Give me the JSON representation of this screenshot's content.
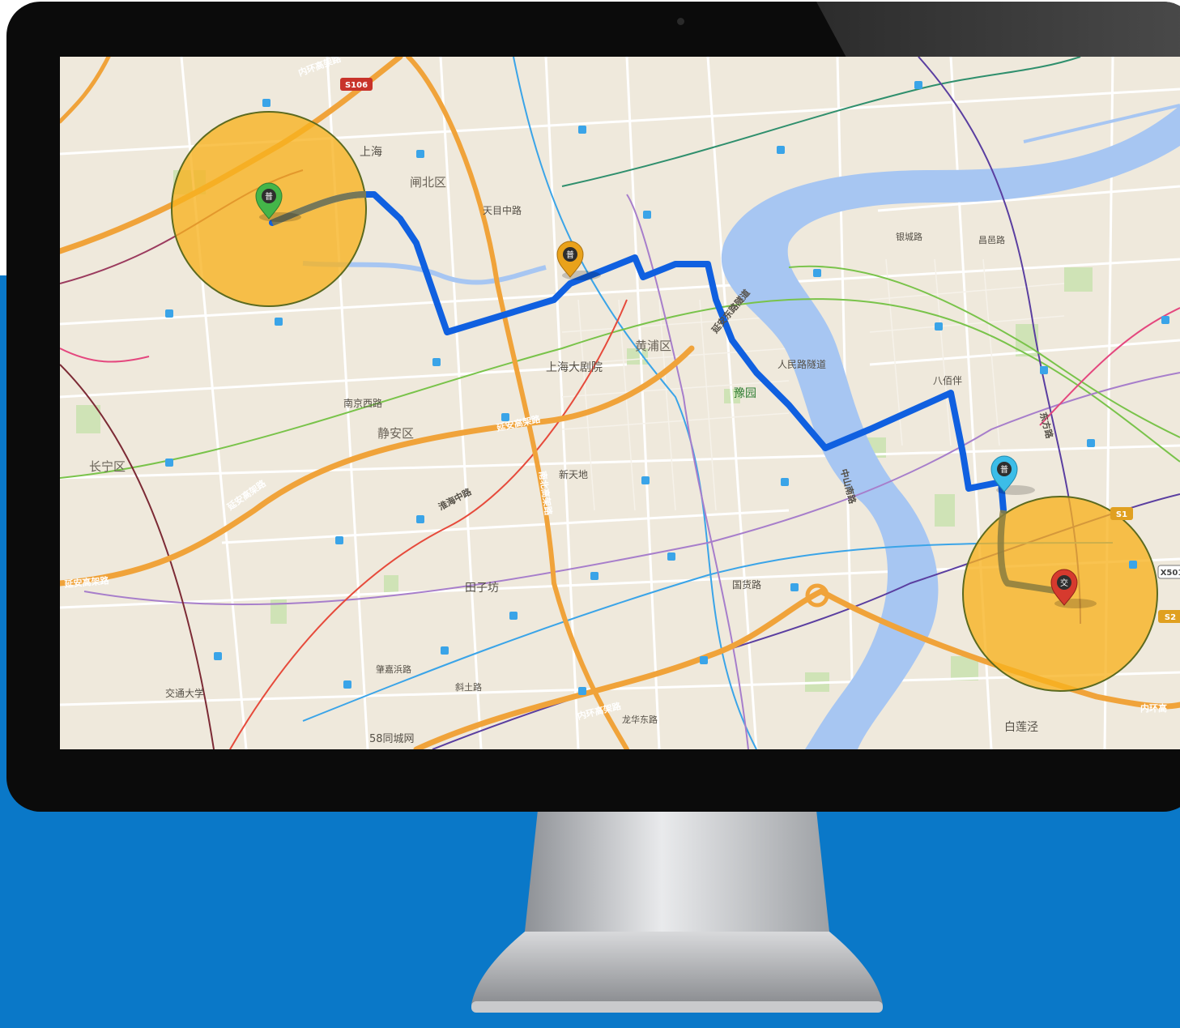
{
  "map": {
    "route_color": "#1060e0",
    "river_color": "#a7c6f2",
    "geofence_color": "#f7b21f",
    "place_labels": [
      {
        "id": "shanghai-station",
        "text": "上海"
      },
      {
        "id": "zhabei",
        "text": "闸北区"
      },
      {
        "id": "tianmu",
        "text": "天目中路"
      },
      {
        "id": "huangpu",
        "text": "黄浦区"
      },
      {
        "id": "grand-theatre",
        "text": "上海大剧院"
      },
      {
        "id": "yuyuan",
        "text": "豫园"
      },
      {
        "id": "renmin-tunnel",
        "text": "人民路隧道"
      },
      {
        "id": "jingan",
        "text": "静安区"
      },
      {
        "id": "nanjing-west",
        "text": "南京西路"
      },
      {
        "id": "xintiandi",
        "text": "新天地"
      },
      {
        "id": "changning",
        "text": "长宁区"
      },
      {
        "id": "tianzifang",
        "text": "田子坊"
      },
      {
        "id": "guojia",
        "text": "国货路"
      },
      {
        "id": "jiaotong",
        "text": "交通大学"
      },
      {
        "id": "58tongcheng",
        "text": "58同城网"
      },
      {
        "id": "bailianjing",
        "text": "白莲泾"
      },
      {
        "id": "babaiban",
        "text": "八佰伴"
      },
      {
        "id": "yincheng",
        "text": "银城路"
      },
      {
        "id": "changyi",
        "text": "昌邑路"
      },
      {
        "id": "longhua",
        "text": "龙华东路"
      },
      {
        "id": "zhaojiabang",
        "text": "肇嘉浜路"
      },
      {
        "id": "xietu",
        "text": "斜土路"
      }
    ],
    "road_labels": [
      {
        "id": "yanan-elev-1",
        "text": "延安高架路"
      },
      {
        "id": "yanan-elev-2",
        "text": "延安高架路"
      },
      {
        "id": "yanan-elev-3",
        "text": "延安高架路"
      },
      {
        "id": "inner-ring-n",
        "text": "内环高架路"
      },
      {
        "id": "inner-ring-s",
        "text": "内环高架路"
      },
      {
        "id": "inner-ring-e",
        "text": "内环高"
      },
      {
        "id": "nanbei-elev",
        "text": "南北高架路"
      },
      {
        "id": "huaihai",
        "text": "淮海中路"
      },
      {
        "id": "dongfang",
        "text": "东方路"
      },
      {
        "id": "zhongshan-s",
        "text": "中山南路"
      },
      {
        "id": "east-yanan",
        "text": "延安东路隧道"
      }
    ],
    "shields": [
      {
        "id": "s106",
        "text": "S106"
      },
      {
        "id": "s1",
        "text": "S1"
      },
      {
        "id": "x5",
        "text": "X501"
      },
      {
        "id": "s2",
        "text": "S2"
      }
    ],
    "markers": [
      {
        "id": "start",
        "glyph": "普",
        "color": "#44b549",
        "icon": "start-pin-icon"
      },
      {
        "id": "waypoint-1",
        "glyph": "普",
        "color": "#e9a21b",
        "icon": "waypoint-pin-icon"
      },
      {
        "id": "waypoint-2",
        "glyph": "普",
        "color": "#3cbde8",
        "icon": "waypoint-pin-icon"
      },
      {
        "id": "end",
        "glyph": "交",
        "color": "#d63a2e",
        "icon": "destination-pin-icon"
      }
    ]
  }
}
